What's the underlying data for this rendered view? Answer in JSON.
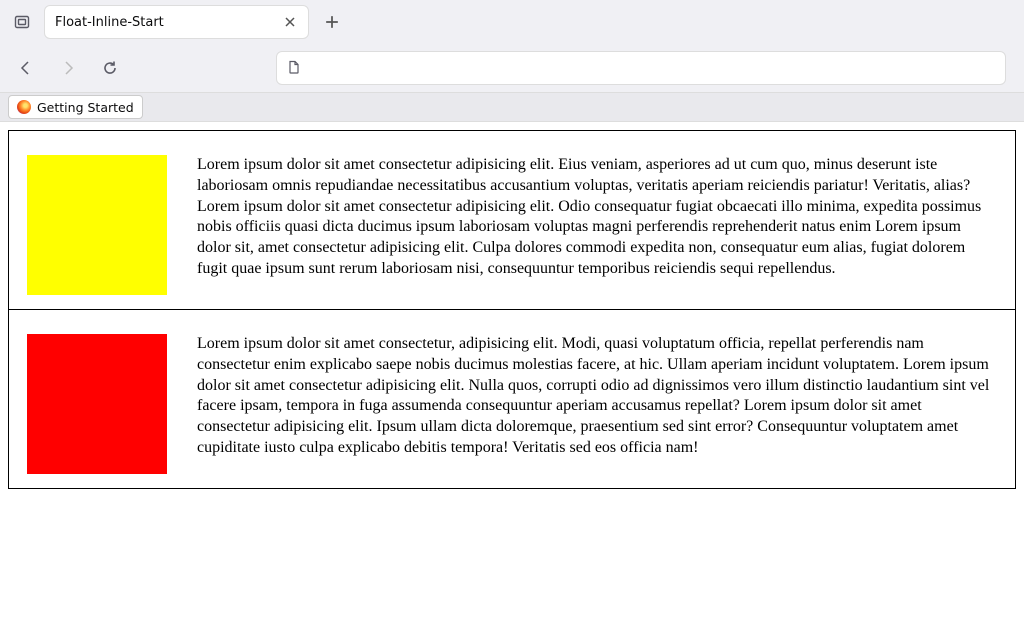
{
  "tab": {
    "title": "Float-Inline-Start"
  },
  "bookmarks": {
    "getting_started": "Getting Started"
  },
  "sections": [
    {
      "box_color": "yellow",
      "text": "Lorem ipsum dolor sit amet consectetur adipisicing elit. Eius veniam, asperiores ad ut cum quo, minus deserunt iste laboriosam omnis repudiandae necessitatibus accusantium voluptas, veritatis aperiam reiciendis pariatur! Veritatis, alias? Lorem ipsum dolor sit amet consectetur adipisicing elit. Odio consequatur fugiat obcaecati illo minima, expedita possimus nobis officiis quasi dicta ducimus ipsum laboriosam voluptas magni perferendis reprehenderit natus enim Lorem ipsum dolor sit, amet consectetur adipisicing elit. Culpa dolores commodi expedita non, consequatur eum alias, fugiat dolorem fugit quae ipsum sunt rerum laboriosam nisi, consequuntur temporibus reiciendis sequi repellendus."
    },
    {
      "box_color": "red",
      "text": "Lorem ipsum dolor sit amet consectetur, adipisicing elit. Modi, quasi voluptatum officia, repellat perferendis nam consectetur enim explicabo saepe nobis ducimus molestias facere, at hic. Ullam aperiam incidunt voluptatem. Lorem ipsum dolor sit amet consectetur adipisicing elit. Nulla quos, corrupti odio ad dignissimos vero illum distinctio laudantium sint vel facere ipsam, tempora in fuga assumenda consequuntur aperiam accusamus repellat? Lorem ipsum dolor sit amet consectetur adipisicing elit. Ipsum ullam dicta doloremque, praesentium sed sint error? Consequuntur voluptatem amet cupiditate iusto culpa explicabo debitis tempora! Veritatis sed eos officia nam!"
    }
  ]
}
